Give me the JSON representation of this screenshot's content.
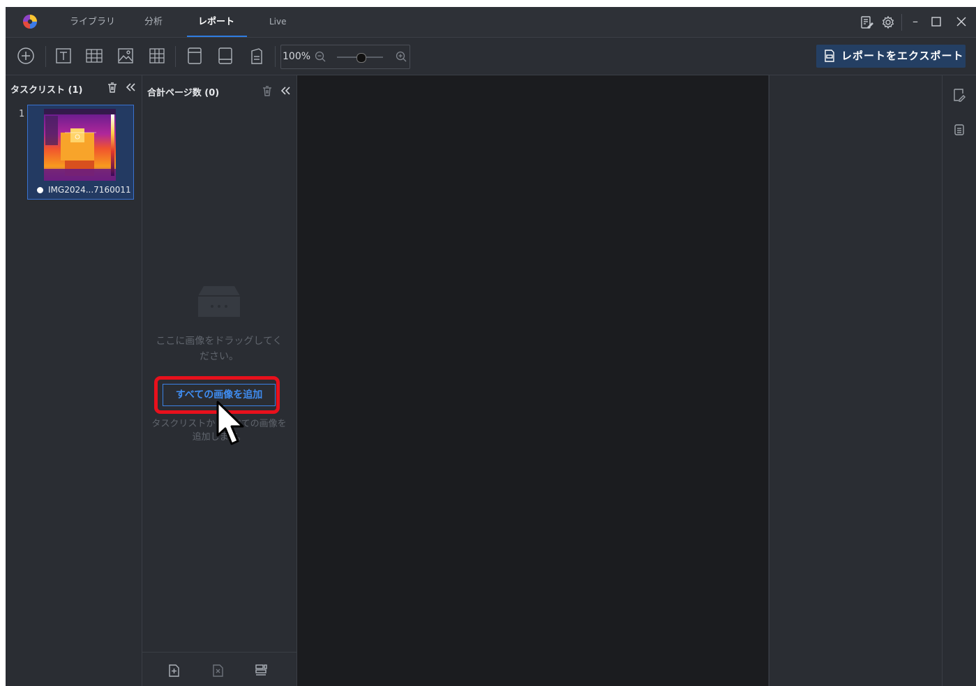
{
  "tabs": [
    {
      "label": "ライブラリ"
    },
    {
      "label": "分析"
    },
    {
      "label": "レポート"
    },
    {
      "label": "Live"
    }
  ],
  "toolbar": {
    "zoom_value": "100%",
    "zoom_level_percent": 100,
    "export_label": "レポートをエクスポート"
  },
  "tasklist": {
    "title": "タスクリスト (1)",
    "items": [
      {
        "index": "1",
        "name": "IMG2024...7160011"
      }
    ]
  },
  "pages": {
    "title": "合計ページ数 (0)",
    "empty_text": "ここに画像をドラッグしてください。",
    "add_all_label": "すべての画像を追加",
    "add_all_hint": "タスクリストからすべての画像を追加します。"
  },
  "colors": {
    "accent": "#2f7de1",
    "highlight": "#e8101c",
    "canvas": "#1b1c1f"
  }
}
